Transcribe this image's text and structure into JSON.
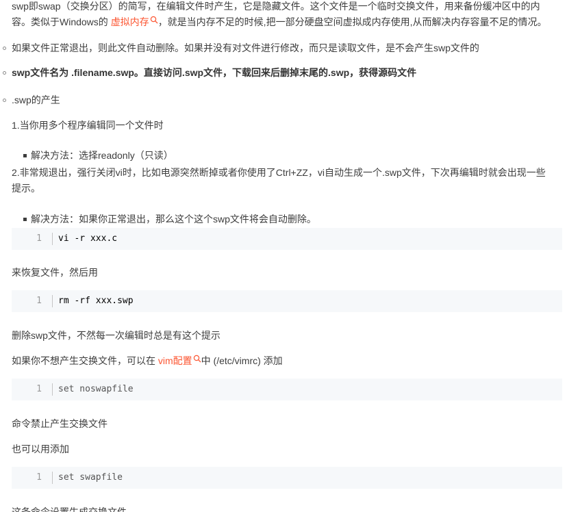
{
  "p1": {
    "line1": "swp即swap（交换分区）的简写，在编辑文件时产生，它是隐藏文件。这个文件是一个临时交换文件，用来备份缓冲区中的内",
    "line2_pre": "容。类似于Windows的 ",
    "line2_link": "虚拟内存",
    "line2_post": "，就是当内存不足的时候,把一部分硬盘空间虚拟成内存使用,从而解决内存容量不足的情况。"
  },
  "p2": "如果文件正常退出，则此文件自动删除。如果并没有对文件进行修改，而只是读取文件，是不会产生swp文件的",
  "p3": "swp文件名为 .filename.swp。直接访问.swp文件，下载回来后删掉末尾的.swp，获得源码文件",
  "p4": ".swp的产生",
  "p5": "1.当你用多个程序编辑同一个文件时",
  "p6": "解决方法：选择readonly（只读）",
  "p7": {
    "line1": "2.非常规退出，强行关闭vi时，比如电源突然断掉或者你使用了Ctrl+ZZ，vi自动生成一个.swp文件，下次再编辑时就会出现一些",
    "line2": "提示。"
  },
  "p8": "解决方法：如果你正常退出，那么这个这个swp文件将会自动删除。",
  "code1": {
    "num": "1",
    "text": "vi -r xxx.c"
  },
  "p9": "来恢复文件，然后用",
  "code2": {
    "num": "1",
    "text": "rm -rf xxx.swp"
  },
  "p10": "删除swp文件，不然每一次编辑时总是有这个提示",
  "p11": {
    "pre": "如果你不想产生交换文件，可以在 ",
    "link": "vim配置",
    "post": "中 (/etc/vimrc) 添加"
  },
  "code3": {
    "num": "1",
    "text": "set noswapfile"
  },
  "p12": "命令禁止产生交换文件",
  "p13": "也可以用添加",
  "code4": {
    "num": "1",
    "text": "set swapfile"
  },
  "p14": "这条命令设置生成交换文件",
  "colors": {
    "text": "#3d3d3d",
    "link": "#fc5531",
    "code_bg": "#f6f8fa"
  }
}
